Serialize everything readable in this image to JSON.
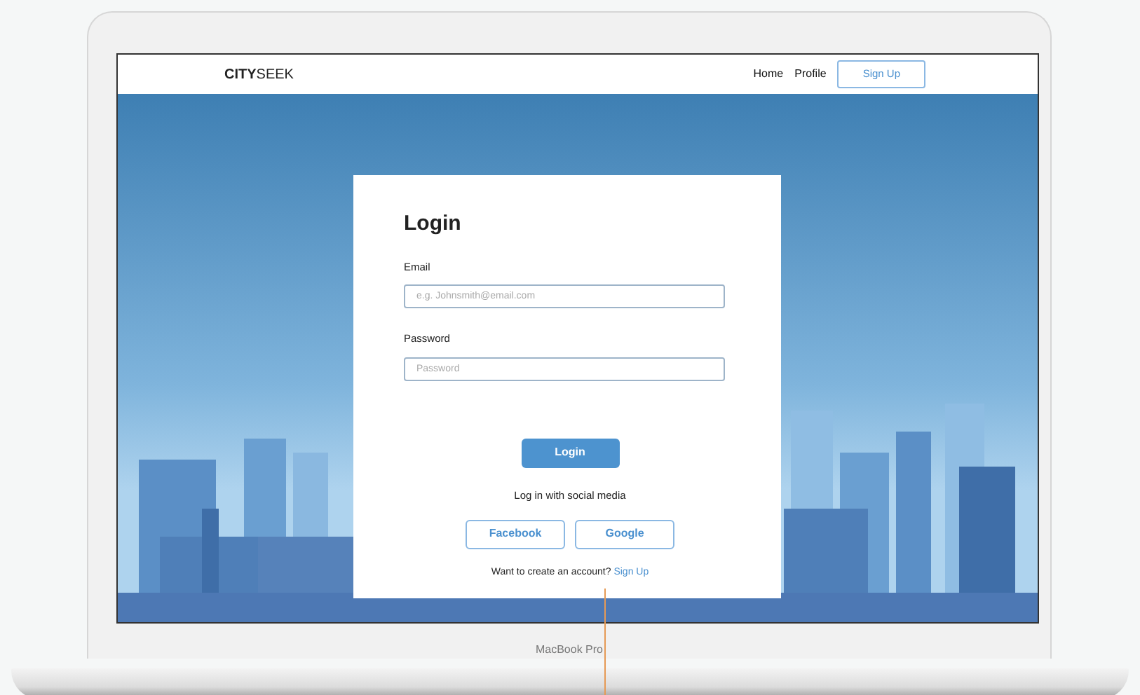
{
  "navbar": {
    "brand": "**CITY**SEEK",
    "links": [
      {
        "label": "Home"
      },
      {
        "label": "Profile"
      }
    ],
    "signup_button": "Sign Up"
  },
  "login_card": {
    "title": "Login",
    "fields": [
      {
        "label": "Email",
        "placeholder": "e.g. Johnsmith@email.com"
      },
      {
        "label": "Password",
        "placeholder": "Password"
      }
    ],
    "login_button": "Login",
    "social_text": "Log in with social media",
    "social_buttons": [
      "Facebook",
      "Google"
    ],
    "signup_prompt": "Want to create an account?",
    "signup_link": "Sign Up"
  },
  "device_label": "MacBook Pro"
}
